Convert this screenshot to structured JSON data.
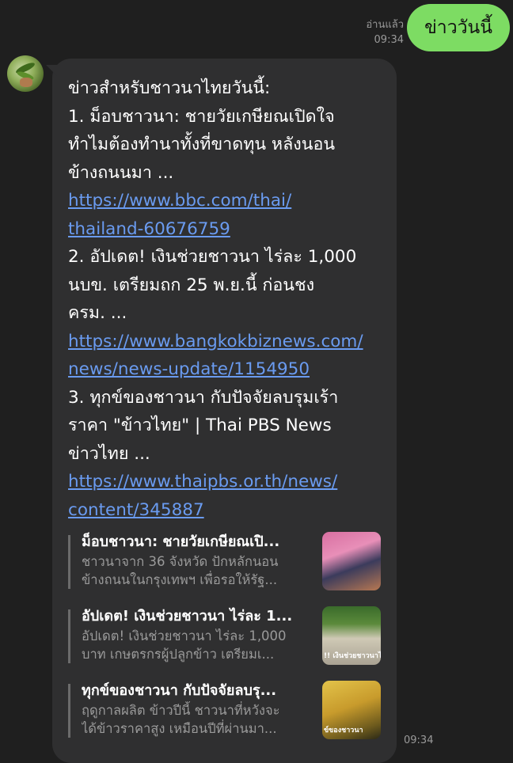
{
  "outgoing": {
    "read_status": "อ่านแล้ว",
    "time": "09:34",
    "text": "ข่าววันนี้"
  },
  "avatar_icon": "rice-farmer-avatar-icon",
  "incoming": {
    "time": "09:34",
    "lines": [
      "ข่าวสำหรับชาวนาไทยวันนี้:",
      "1. ม็อบชาวนา: ชายวัยเกษียณเปิดใจ",
      "ทำไมต้องทำนาทั้งที่ขาดทุน หลังนอน",
      "ข้างถนนมา ..."
    ],
    "link1": [
      "https://www.bbc.com/thai/",
      "thailand-60676759"
    ],
    "lines2": [
      "2. อัปเดต! เงินช่วยชาวนา ไร่ละ 1,000",
      "นบข. เตรียมถก 25 พ.ย.นี้ ก่อนชง",
      "ครม. ..."
    ],
    "link2": [
      "https://www.bangkokbiznews.com/",
      "news/news-update/1154950"
    ],
    "lines3": [
      "3. ทุกข์ของชาวนา กับปัจจัยลบรุมเร้า",
      "ราคา \"ข้าวไทย\" | Thai PBS News",
      "ข่าวไทย ..."
    ],
    "link3": [
      "https://www.thaipbs.or.th/news/",
      "content/345887"
    ],
    "previews": [
      {
        "title": "ม็อบชาวนา: ชายวัยเกษียณเปิ...",
        "desc": [
          "ชาวนาจาก 36 จังหวัด ปักหลักนอน",
          "ข้างถนนในกรุงเทพฯ เพื่อรอให้รัฐ..."
        ],
        "thumb_caption": ""
      },
      {
        "title": "อัปเดต! เงินช่วยชาวนา ไร่ละ 1...",
        "desc": [
          "อัปเดต! เงินช่วยชาวนา ไร่ละ 1,000",
          "บาท เกษตรกรผู้ปลูกข้าว เตรียมเ..."
        ],
        "thumb_caption": "!! เงินช่วยชาวนาไร่ละ"
      },
      {
        "title": "ทุกข์ของชาวนา กับปัจจัยลบรุ...",
        "desc": [
          "ฤดูกาลผลิต ข้าวปีนี้ ชาวนาที่หวังจะ",
          "ได้ข้าวราคาสูง เหมือนปีที่ผ่านมา..."
        ],
        "thumb_caption": "ข์ของชาวนา"
      }
    ]
  },
  "colors": {
    "background": "#1f1f1f",
    "outgoing_bubble": "#7ddc63",
    "incoming_bubble": "#2f2f30",
    "link": "#6a9bf0"
  }
}
